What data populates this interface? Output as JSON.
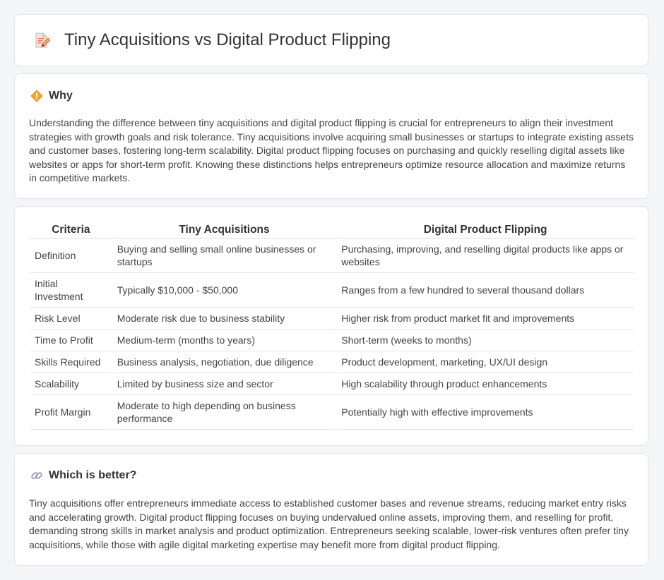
{
  "header": {
    "title": "Tiny Acquisitions vs Digital Product Flipping"
  },
  "why": {
    "title": "Why",
    "text": "Understanding the difference between tiny acquisitions and digital product flipping is crucial for entrepreneurs to align their investment strategies with growth goals and risk tolerance. Tiny acquisitions involve acquiring small businesses or startups to integrate existing assets and customer bases, fostering long-term scalability. Digital product flipping focuses on purchasing and quickly reselling digital assets like websites or apps for short-term profit. Knowing these distinctions helps entrepreneurs optimize resource allocation and maximize returns in competitive markets."
  },
  "table": {
    "headers": [
      "Criteria",
      "Tiny Acquisitions",
      "Digital Product Flipping"
    ],
    "rows": [
      [
        "Definition",
        "Buying and selling small online businesses or startups",
        "Purchasing, improving, and reselling digital products like apps or websites"
      ],
      [
        "Initial Investment",
        "Typically $10,000 - $50,000",
        "Ranges from a few hundred to several thousand dollars"
      ],
      [
        "Risk Level",
        "Moderate risk due to business stability",
        "Higher risk from product market fit and improvements"
      ],
      [
        "Time to Profit",
        "Medium-term (months to years)",
        "Short-term (weeks to months)"
      ],
      [
        "Skills Required",
        "Business analysis, negotiation, due diligence",
        "Product development, marketing, UX/UI design"
      ],
      [
        "Scalability",
        "Limited by business size and sector",
        "High scalability through product enhancements"
      ],
      [
        "Profit Margin",
        "Moderate to high depending on business performance",
        "Potentially high with effective improvements"
      ]
    ]
  },
  "better": {
    "title": "Which is better?",
    "text": "Tiny acquisitions offer entrepreneurs immediate access to established customer bases and revenue streams, reducing market entry risks and accelerating growth. Digital product flipping focuses on buying undervalued online assets, improving them, and reselling for profit, demanding strong skills in market analysis and product optimization. Entrepreneurs seeking scalable, lower-risk ventures often prefer tiny acquisitions, while those with agile digital marketing expertise may benefit more from digital product flipping."
  },
  "icons": {
    "header": "document-pencil-icon",
    "why": "warning-diamond-icon",
    "better": "link-icon"
  }
}
